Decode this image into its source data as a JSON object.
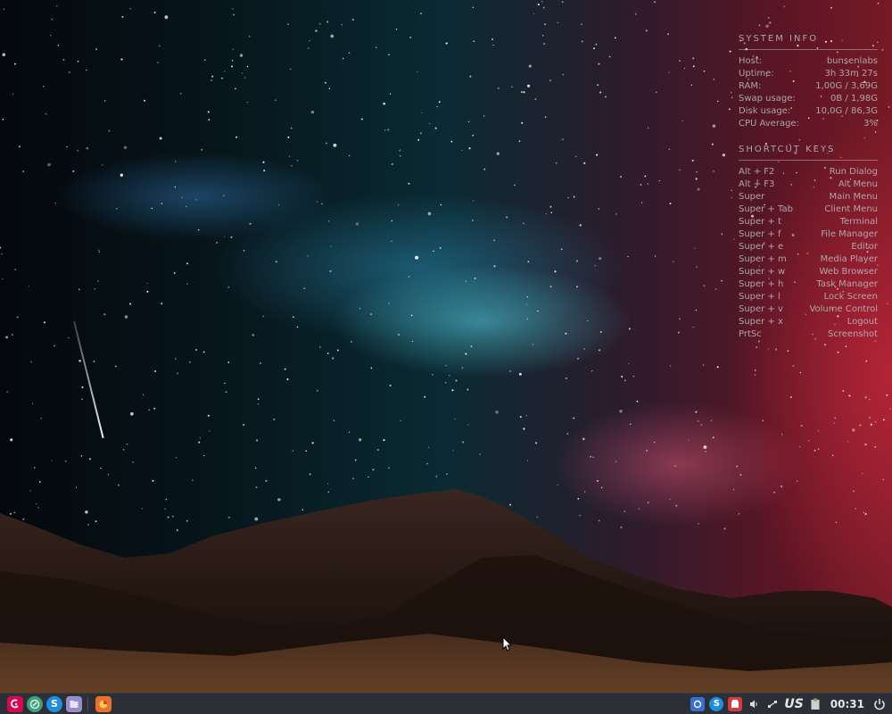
{
  "conky": {
    "system_header": "SYSTEM INFO",
    "system_rows": [
      {
        "label": "Host:",
        "value": "bunsenlabs"
      },
      {
        "label": "Uptime:",
        "value": "3h 33m 27s"
      },
      {
        "label": "RAM:",
        "value": "1,00G / 3,69G"
      },
      {
        "label": "Swap usage:",
        "value": "0B / 1,98G"
      },
      {
        "label": "Disk usage:",
        "value": "10,0G / 86,3G"
      },
      {
        "label": "CPU Average:",
        "value": "3%"
      }
    ],
    "shortcut_header": "SHORTCUT KEYS",
    "shortcut_rows": [
      {
        "label": "Alt + F2",
        "value": "Run Dialog"
      },
      {
        "label": "Alt + F3",
        "value": "Alt Menu"
      },
      {
        "label": "Super",
        "value": "Main Menu"
      },
      {
        "label": "Super + Tab",
        "value": "Client Menu"
      },
      {
        "label": "Super + t",
        "value": "Terminal"
      },
      {
        "label": "Super + f",
        "value": "File Manager"
      },
      {
        "label": "Super + e",
        "value": "Editor"
      },
      {
        "label": "Super + m",
        "value": "Media Player"
      },
      {
        "label": "Super + w",
        "value": "Web Browser"
      },
      {
        "label": "Super + h",
        "value": "Task Manager"
      },
      {
        "label": "Super + l",
        "value": "Lock Screen"
      },
      {
        "label": "Super + v",
        "value": "Volume Control"
      },
      {
        "label": "Super + x",
        "value": "Logout"
      },
      {
        "label": "PrtSc",
        "value": "Screenshot"
      }
    ]
  },
  "taskbar": {
    "launchers": [
      {
        "icon": "debian-menu-icon",
        "color": "#d70751"
      },
      {
        "icon": "web-browser-icon",
        "color": "#3aa37a"
      },
      {
        "icon": "skype-icon",
        "glyph": "S",
        "color": "#1e8fe0"
      },
      {
        "icon": "file-manager-icon",
        "color": "#9a8cc8"
      }
    ],
    "running": [
      {
        "icon": "firefox-icon",
        "color": "#e8712c"
      }
    ],
    "tray": {
      "keyboard_layout": "US",
      "clock": "00:31"
    }
  },
  "colors": {
    "taskbar_bg": "#2c3036",
    "conky_text": "#b9bec4"
  }
}
